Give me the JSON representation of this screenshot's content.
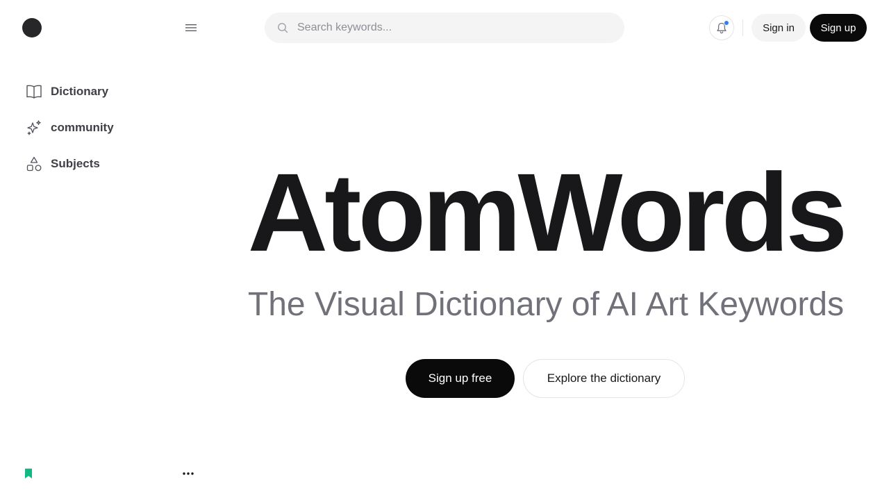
{
  "header": {
    "search_placeholder": "Search keywords...",
    "signin_label": "Sign in",
    "signup_label": "Sign up",
    "notification_dot_color": "#2f7cf6"
  },
  "sidebar": {
    "items": [
      {
        "label": "Dictionary",
        "icon": "book-open-icon"
      },
      {
        "label": "community",
        "icon": "sparkles-icon"
      },
      {
        "label": "Subjects",
        "icon": "shapes-icon"
      }
    ],
    "footer": {
      "bookmark_icon": "bookmark-icon",
      "bookmark_color": "#10b981",
      "more_icon": "more-icon"
    }
  },
  "hero": {
    "title": "AtomWords",
    "subtitle": "The Visual Dictionary of AI Art Keywords",
    "primary_cta": "Sign up free",
    "secondary_cta": "Explore the dictionary"
  }
}
